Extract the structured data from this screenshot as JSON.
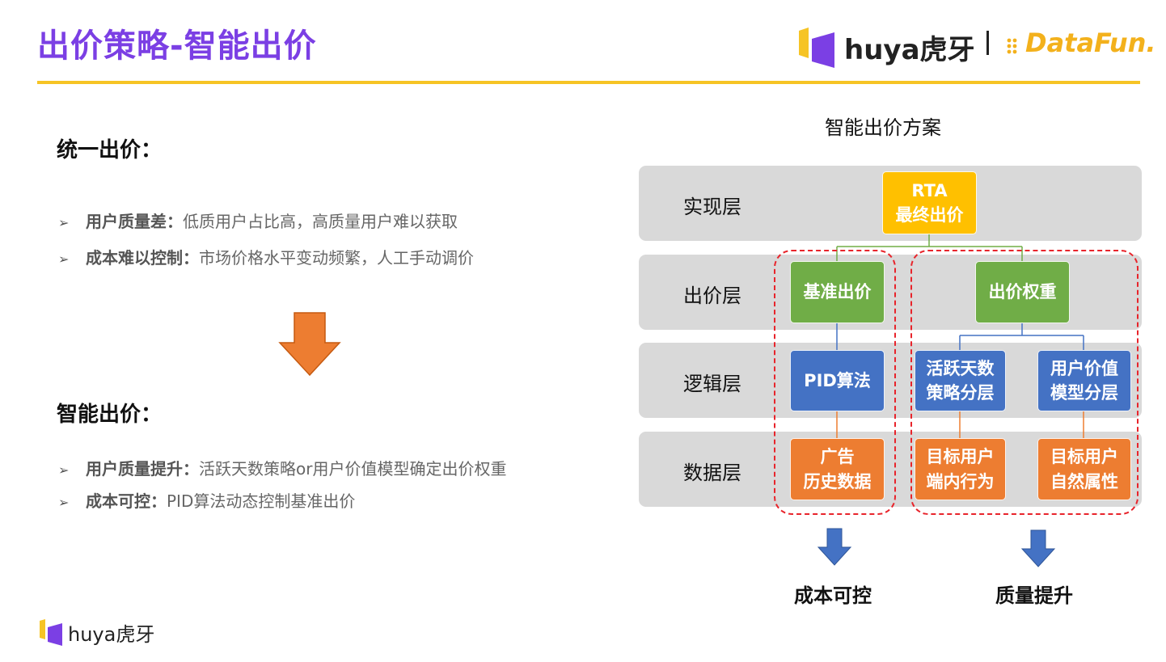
{
  "slide": {
    "title": "出价策略-智能出价"
  },
  "brand": {
    "huya_text": "huya虎牙",
    "datafun_text": "DataFun."
  },
  "left": {
    "section1": {
      "heading": "统一出价：",
      "bullets": [
        {
          "bold": "用户质量差：",
          "text": "低质用户占比高，高质量用户难以获取"
        },
        {
          "bold": "成本难以控制：",
          "text": "市场价格水平变动频繁，人工手动调价"
        }
      ]
    },
    "section2": {
      "heading": "智能出价：",
      "bullets": [
        {
          "bold": "用户质量提升：",
          "text": "活跃天数策略or用户价值模型确定出价权重"
        },
        {
          "bold": "成本可控：",
          "text": "PID算法动态控制基准出价"
        }
      ]
    },
    "bullet_mark": "➢"
  },
  "diagram": {
    "title": "智能出价方案",
    "layers": [
      "实现层",
      "出价层",
      "逻辑层",
      "数据层"
    ],
    "nodes": {
      "rta": "RTA\n最终出价",
      "base_bid": "基准出价",
      "bid_weight": "出价权重",
      "pid": "PID算法",
      "active_days": "活跃天数\n策略分层",
      "user_value": "用户价值\n模型分层",
      "ad_history": "广告\n历史数据",
      "in_app_behavior": "目标用户\n端内行为",
      "natural_attr": "目标用户\n自然属性"
    },
    "outcomes": [
      "成本可控",
      "质量提升"
    ]
  },
  "colors": {
    "title_purple": "#7b3fe4",
    "rule_yellow": "#f6c425",
    "node_yellow": "#ffc000",
    "node_green": "#70ad47",
    "node_blue": "#4472c4",
    "node_orange": "#ed7d31",
    "arrow_orange": "#ed7d31",
    "arrow_blue": "#4472c4",
    "dashed_red": "#e8242b",
    "layer_gray": "#d9d9d9"
  }
}
